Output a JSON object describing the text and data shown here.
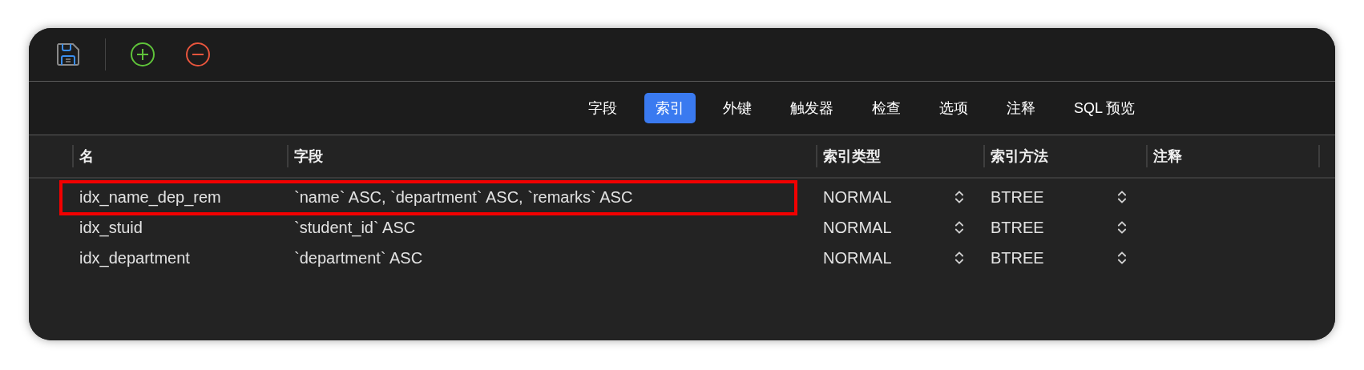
{
  "toolbar": {
    "buttons": [
      {
        "kind": "save"
      },
      {
        "kind": "add"
      },
      {
        "kind": "remove"
      }
    ]
  },
  "tabs": [
    {
      "label": "字段",
      "selected": false
    },
    {
      "label": "索引",
      "selected": true
    },
    {
      "label": "外键",
      "selected": false
    },
    {
      "label": "触发器",
      "selected": false
    },
    {
      "label": "检查",
      "selected": false
    },
    {
      "label": "选项",
      "selected": false
    },
    {
      "label": "注释",
      "selected": false
    },
    {
      "label": "SQL 预览",
      "selected": false
    }
  ],
  "table": {
    "columns": [
      "名",
      "字段",
      "索引类型",
      "索引方法",
      "注释"
    ],
    "rows": [
      {
        "name": "idx_name_dep_rem",
        "fields": "`name` ASC, `department` ASC, `remarks` ASC",
        "index_type": "NORMAL",
        "index_method": "BTREE",
        "highlighted": true
      },
      {
        "name": "idx_stuid",
        "fields": "`student_id` ASC",
        "index_type": "NORMAL",
        "index_method": "BTREE",
        "highlighted": false
      },
      {
        "name": "idx_department",
        "fields": "`department` ASC",
        "index_type": "NORMAL",
        "index_method": "BTREE",
        "highlighted": false
      }
    ]
  }
}
